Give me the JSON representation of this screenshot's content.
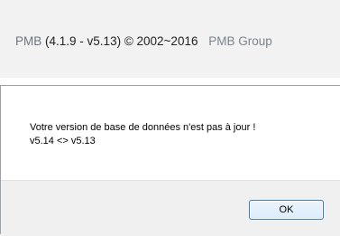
{
  "footer": {
    "app_name": "PMB",
    "version": "(4.1.9 - v5.13) © 2002~2016",
    "group": "PMB Group"
  },
  "dialog": {
    "message_line1": "Votre version de base de données n'est pas à jour !",
    "message_line2": "v5.14 <> v5.13",
    "ok_label": "OK"
  }
}
